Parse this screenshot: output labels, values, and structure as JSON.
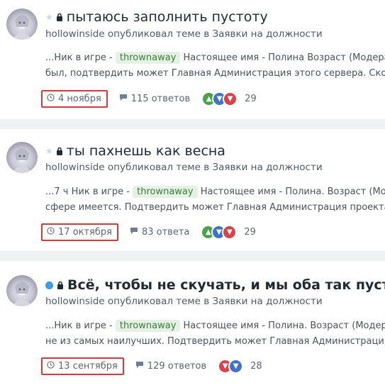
{
  "threads": [
    {
      "marker": "star",
      "title": "пытаюсь заполнить пустоту",
      "title_bold": false,
      "author": "hollowinside",
      "byline_text": "опубликовал теме в Заявки на должности",
      "snippet_pre": "...Ник в игре -",
      "tag": "thrownaway",
      "snippet_post": "Настоящее имя - Полина Возраст (Модератор",
      "snippet_line2": "был, подтвердить может Главная Администрация этого сервера. Сколько",
      "date": "4 ноября",
      "answers": "115 ответов",
      "reactions": [
        "upvote-icon",
        "downvote-blue-icon",
        "downvote-red-icon"
      ],
      "score": "29"
    },
    {
      "marker": "star",
      "title": "ты пахнешь как весна",
      "title_bold": false,
      "author": "hollowinside",
      "byline_text": "опубликовал теме в Заявки на должности",
      "snippet_pre": "...7 ч Ник в игре -",
      "tag": "thrownaway",
      "snippet_post": "Настоящее имя - Полина. Возраст (Модерат",
      "snippet_line2": "сфере имеется. Подтвердить может Главная Администрация проекта. Ско",
      "date": "17 октября",
      "answers": "83 ответа",
      "reactions": [
        "upvote-icon",
        "downvote-blue-icon",
        "downvote-red-icon"
      ],
      "score": "29"
    },
    {
      "marker": "unread-dot",
      "title": "Всё, чтобы не скучать, и мы оба так пусты",
      "title_bold": true,
      "author": "hollowinside",
      "byline_text": "опубликовал теме в Заявки на должности",
      "snippet_pre": "...Ник в игре -",
      "tag": "thrownaway",
      "snippet_post": "Настоящее имя - Полина. Возраст (Модератор",
      "snippet_line2": "не из самых наилучших. Подтвердить может Главная Администрация серв",
      "date": "13 сентября",
      "answers": "129 ответов",
      "reactions": [
        "downvote-red-icon",
        "downvote-blue-icon"
      ],
      "score": "28"
    }
  ],
  "colors": {
    "highlight_box": "#d33a3a",
    "tag_bg": "#e4f1e4",
    "tag_text": "#3f7a3d",
    "unread_dot": "#3b9be6"
  }
}
